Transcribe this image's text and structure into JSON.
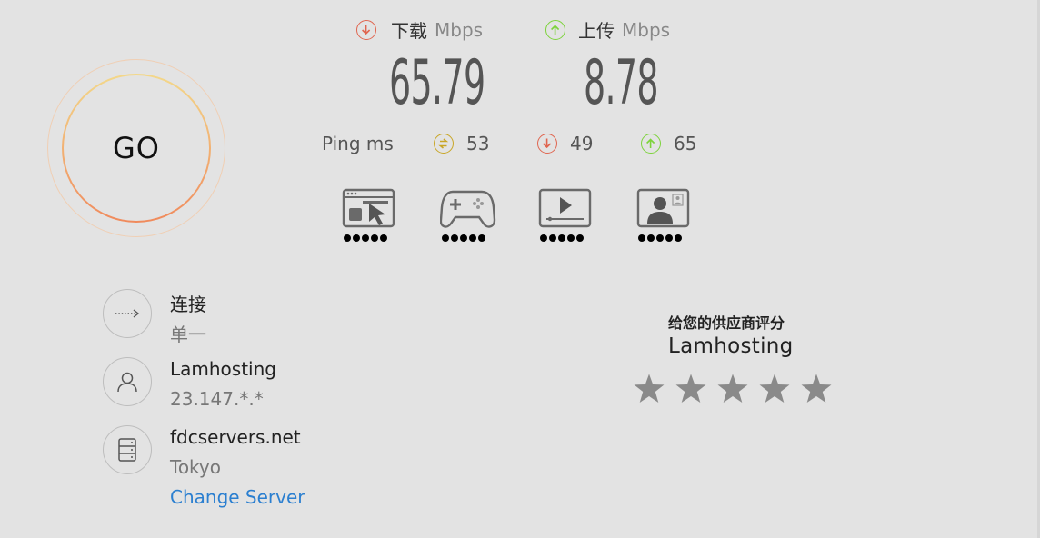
{
  "go_button": {
    "label": "GO"
  },
  "download": {
    "label": "下载",
    "unit": "Mbps",
    "value": "65.79"
  },
  "upload": {
    "label": "上传",
    "unit": "Mbps",
    "value": "8.78"
  },
  "ping": {
    "label": "Ping",
    "unit": "ms",
    "idle": "53",
    "download": "49",
    "upload": "65"
  },
  "quality": [
    {
      "icon": "web-browsing-icon",
      "rating_dots": 5
    },
    {
      "icon": "gaming-icon",
      "rating_dots": 5
    },
    {
      "icon": "video-streaming-icon",
      "rating_dots": 5
    },
    {
      "icon": "video-chat-icon",
      "rating_dots": 5
    }
  ],
  "connection": {
    "title": "连接",
    "value": "单一"
  },
  "isp": {
    "name": "Lamhosting",
    "ip": "23.147.*.*"
  },
  "server": {
    "host": "fdcservers.net",
    "location": "Tokyo",
    "change_label": "Change Server"
  },
  "rating": {
    "title": "给您的供应商评分",
    "isp": "Lamhosting",
    "stars": 5
  },
  "colors": {
    "download": "#e0654f",
    "upload": "#7cd33a",
    "jitter": "#c9a626",
    "link": "#2b7fd0"
  }
}
